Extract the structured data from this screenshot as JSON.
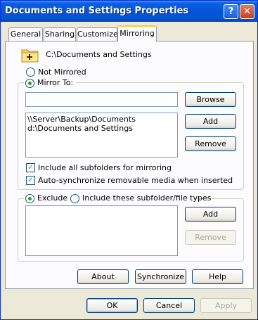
{
  "window": {
    "title": "Documents and Settings Properties"
  },
  "titlebar_buttons": {
    "help": "?",
    "close": "✕"
  },
  "tabs": [
    {
      "label": "General"
    },
    {
      "label": "Sharing"
    },
    {
      "label": "Customize"
    },
    {
      "label": "Mirroring"
    }
  ],
  "folder": {
    "path": "C:\\Documents and Settings",
    "icon": "folder-plus-icon"
  },
  "mirror": {
    "not_mirrored_label": "Not Mirrored",
    "mirror_to_label": "Mirror To:",
    "selected": "mirror_to",
    "input_value": "",
    "list": [
      "\\\\Server\\Backup\\Documents",
      "d:\\Documents and Settings"
    ],
    "browse_label": "Browse",
    "add_label": "Add",
    "remove_label": "Remove",
    "include_subfolders_label": "Include all subfolders for mirroring",
    "include_subfolders_checked": true,
    "auto_sync_label": "Auto-synchronize removable media when inserted",
    "auto_sync_checked": true
  },
  "filter": {
    "exclude_label": "Exclude",
    "include_label": "Include these subfolder/file types",
    "selected": "exclude",
    "add_label": "Add",
    "remove_label": "Remove"
  },
  "panel_buttons": {
    "about": "About",
    "synchronize": "Synchronize",
    "help": "Help"
  },
  "dialog_buttons": {
    "ok": "OK",
    "cancel": "Cancel",
    "apply": "Apply"
  }
}
